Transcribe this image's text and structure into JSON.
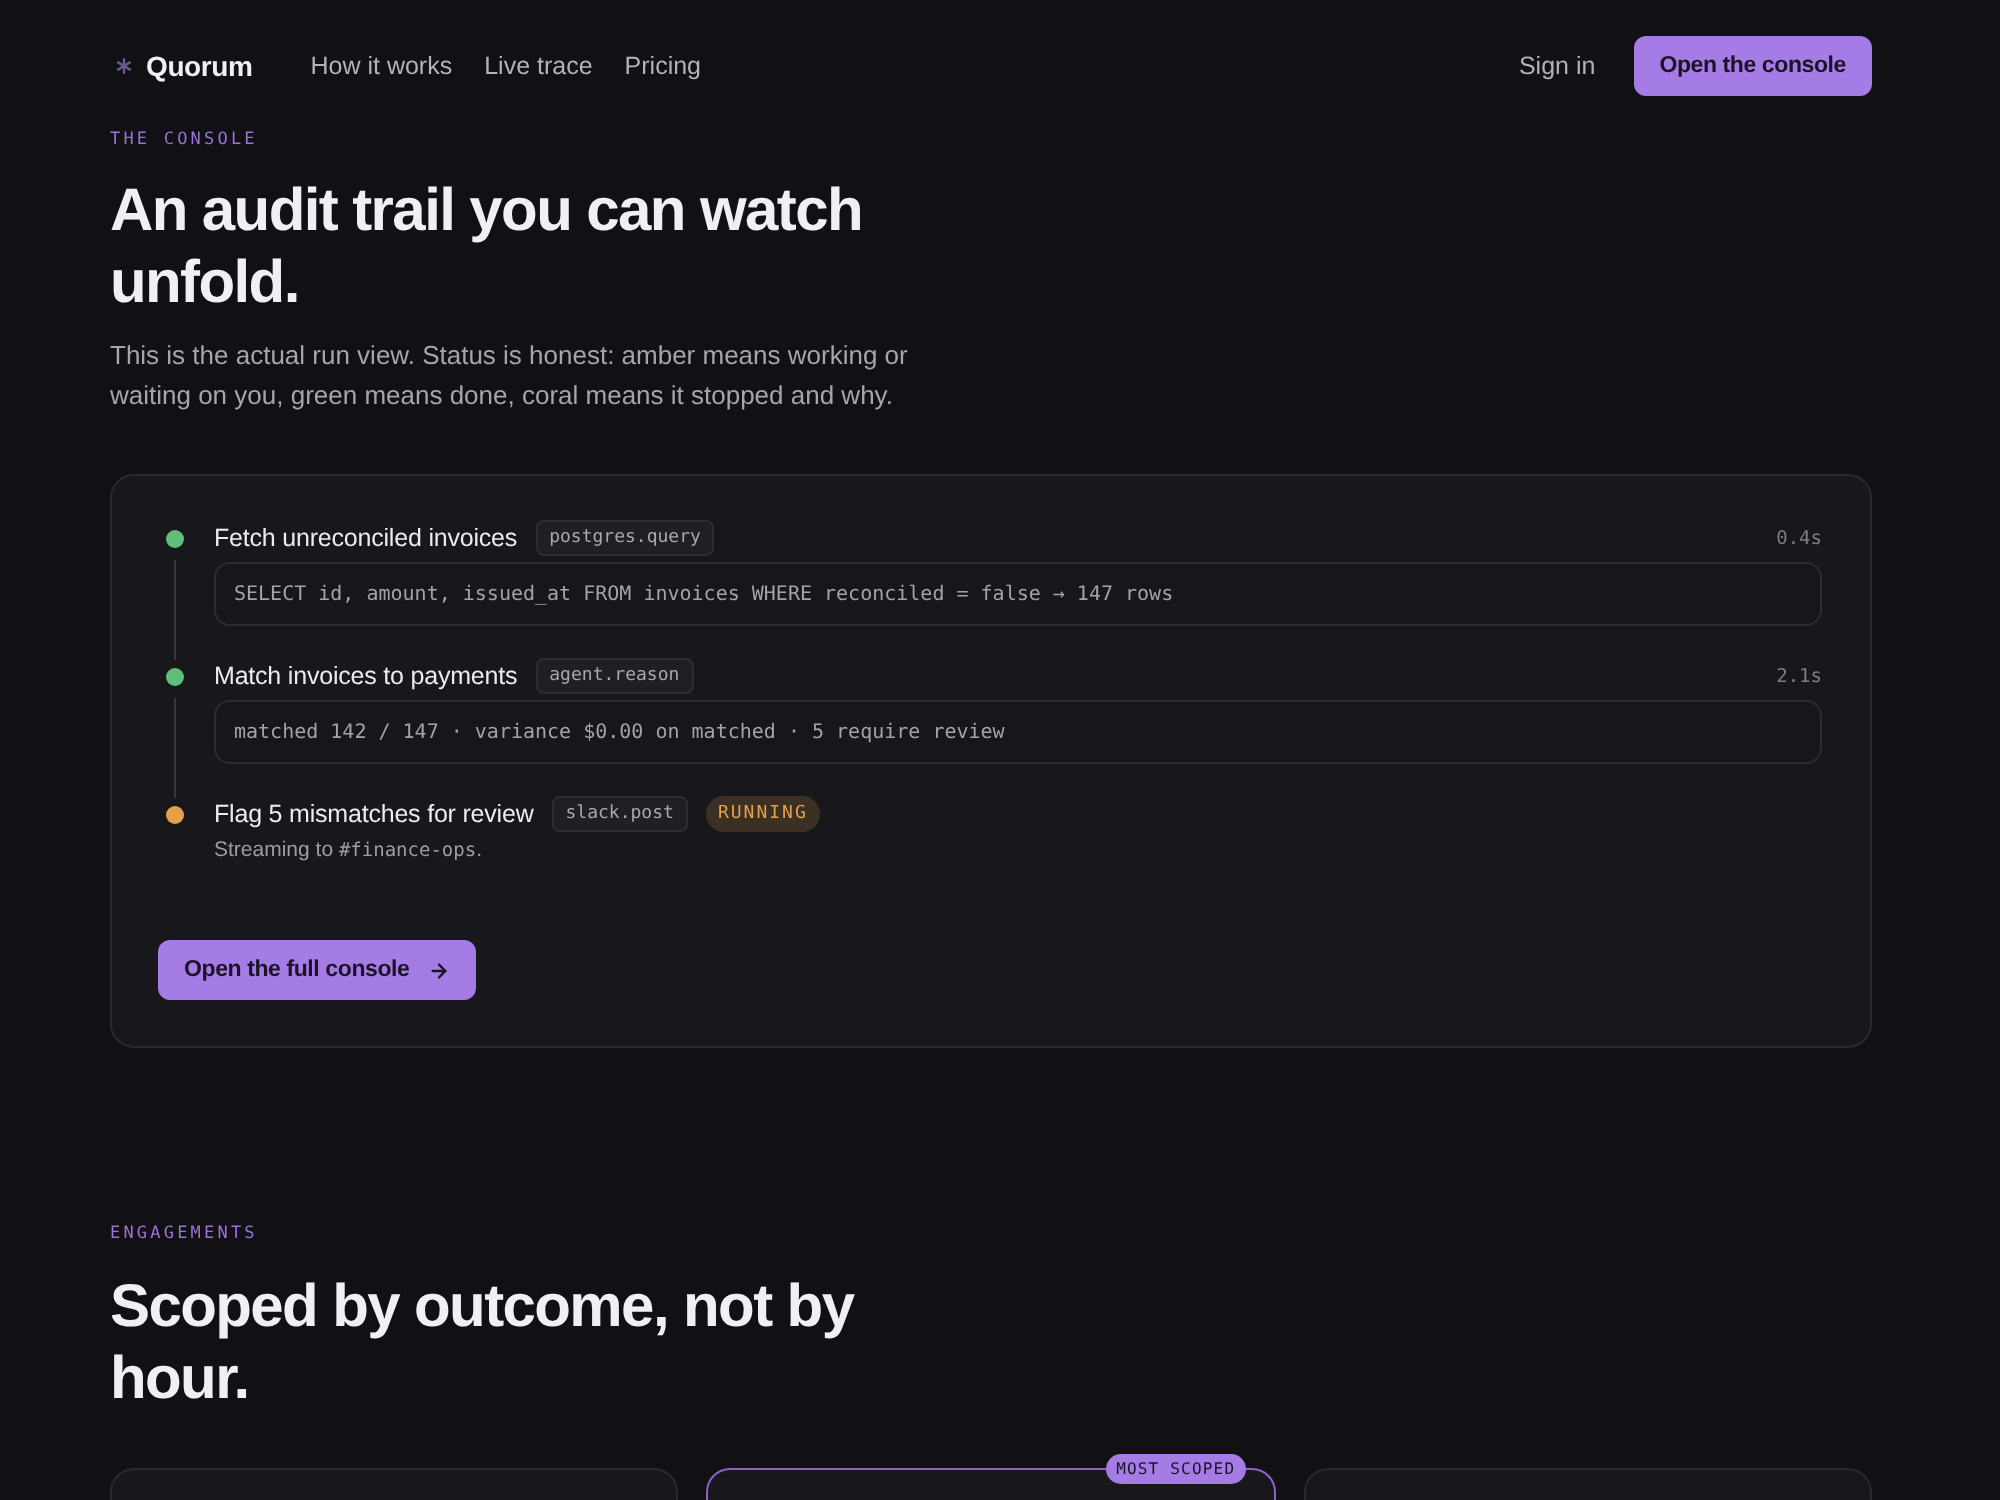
{
  "nav": {
    "brand": "Quorum",
    "links": [
      "How it works",
      "Live trace",
      "Pricing"
    ],
    "sign_in": "Sign in",
    "cta": "Open the console"
  },
  "console_section": {
    "eyebrow": "THE CONSOLE",
    "heading": "An audit trail you can watch unfold.",
    "intro": "This is the actual run view. Status is honest: amber means working or waiting on you, green means done, coral means it stopped and why.",
    "steps": [
      {
        "title": "Fetch unreconciled invoices",
        "tool": "postgres.query",
        "color": "#5fbf7a",
        "duration": "0.4s",
        "output": "SELECT id, amount, issued_at FROM invoices WHERE reconciled = false → 147 rows"
      },
      {
        "title": "Match invoices to payments",
        "tool": "agent.reason",
        "color": "#5fbf7a",
        "duration": "2.1s",
        "output": "matched 142 / 147 · variance $0.00 on matched · 5 require review"
      },
      {
        "title": "Flag 5 mismatches for review",
        "tool": "slack.post",
        "color": "#e3a24a",
        "badge": "RUNNING",
        "note": [
          {
            "kind": "plain",
            "text": "Streaming to "
          },
          {
            "kind": "code",
            "text": "#finance-ops"
          },
          {
            "kind": "plain",
            "text": "."
          }
        ]
      }
    ],
    "button": "Open the full console"
  },
  "engagements_section": {
    "eyebrow": "ENGAGEMENTS",
    "heading": "Scoped by outcome, not by hour.",
    "plans": [
      {
        "featured": false
      },
      {
        "featured": true,
        "badge": "MOST SCOPED"
      },
      {
        "featured": false
      }
    ]
  }
}
